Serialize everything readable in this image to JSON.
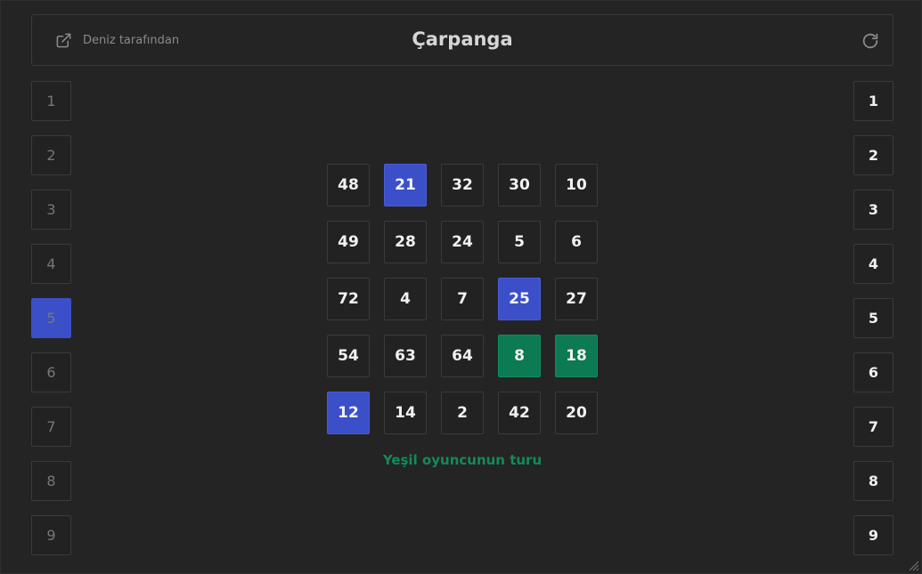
{
  "header": {
    "author": "Deniz tarafından",
    "title": "Çarpanga",
    "external_link_icon": "external-link-icon",
    "refresh_icon": "refresh-icon"
  },
  "left_factors": [
    {
      "label": "1",
      "state": "none"
    },
    {
      "label": "2",
      "state": "none"
    },
    {
      "label": "3",
      "state": "none"
    },
    {
      "label": "4",
      "state": "none"
    },
    {
      "label": "5",
      "state": "blue"
    },
    {
      "label": "6",
      "state": "none"
    },
    {
      "label": "7",
      "state": "none"
    },
    {
      "label": "8",
      "state": "none"
    },
    {
      "label": "9",
      "state": "none"
    }
  ],
  "right_factors": [
    {
      "label": "1",
      "state": "none"
    },
    {
      "label": "2",
      "state": "none"
    },
    {
      "label": "3",
      "state": "none"
    },
    {
      "label": "4",
      "state": "none"
    },
    {
      "label": "5",
      "state": "none"
    },
    {
      "label": "6",
      "state": "none"
    },
    {
      "label": "7",
      "state": "none"
    },
    {
      "label": "8",
      "state": "none"
    },
    {
      "label": "9",
      "state": "none"
    }
  ],
  "board": [
    [
      {
        "v": "48",
        "s": "none"
      },
      {
        "v": "21",
        "s": "blue"
      },
      {
        "v": "32",
        "s": "none"
      },
      {
        "v": "30",
        "s": "none"
      },
      {
        "v": "10",
        "s": "none"
      }
    ],
    [
      {
        "v": "49",
        "s": "none"
      },
      {
        "v": "28",
        "s": "none"
      },
      {
        "v": "24",
        "s": "none"
      },
      {
        "v": "5",
        "s": "none"
      },
      {
        "v": "6",
        "s": "none"
      }
    ],
    [
      {
        "v": "72",
        "s": "none"
      },
      {
        "v": "4",
        "s": "none"
      },
      {
        "v": "7",
        "s": "none"
      },
      {
        "v": "25",
        "s": "blue"
      },
      {
        "v": "27",
        "s": "none"
      }
    ],
    [
      {
        "v": "54",
        "s": "none"
      },
      {
        "v": "63",
        "s": "none"
      },
      {
        "v": "64",
        "s": "none"
      },
      {
        "v": "8",
        "s": "green"
      },
      {
        "v": "18",
        "s": "green"
      }
    ],
    [
      {
        "v": "12",
        "s": "blue"
      },
      {
        "v": "14",
        "s": "none"
      },
      {
        "v": "2",
        "s": "none"
      },
      {
        "v": "42",
        "s": "none"
      },
      {
        "v": "20",
        "s": "none"
      }
    ]
  ],
  "status": "Yeşil oyuncunun turu",
  "colors": {
    "blue": "#3b4fc9",
    "green": "#0c7a53",
    "status_green": "#138a5a"
  }
}
